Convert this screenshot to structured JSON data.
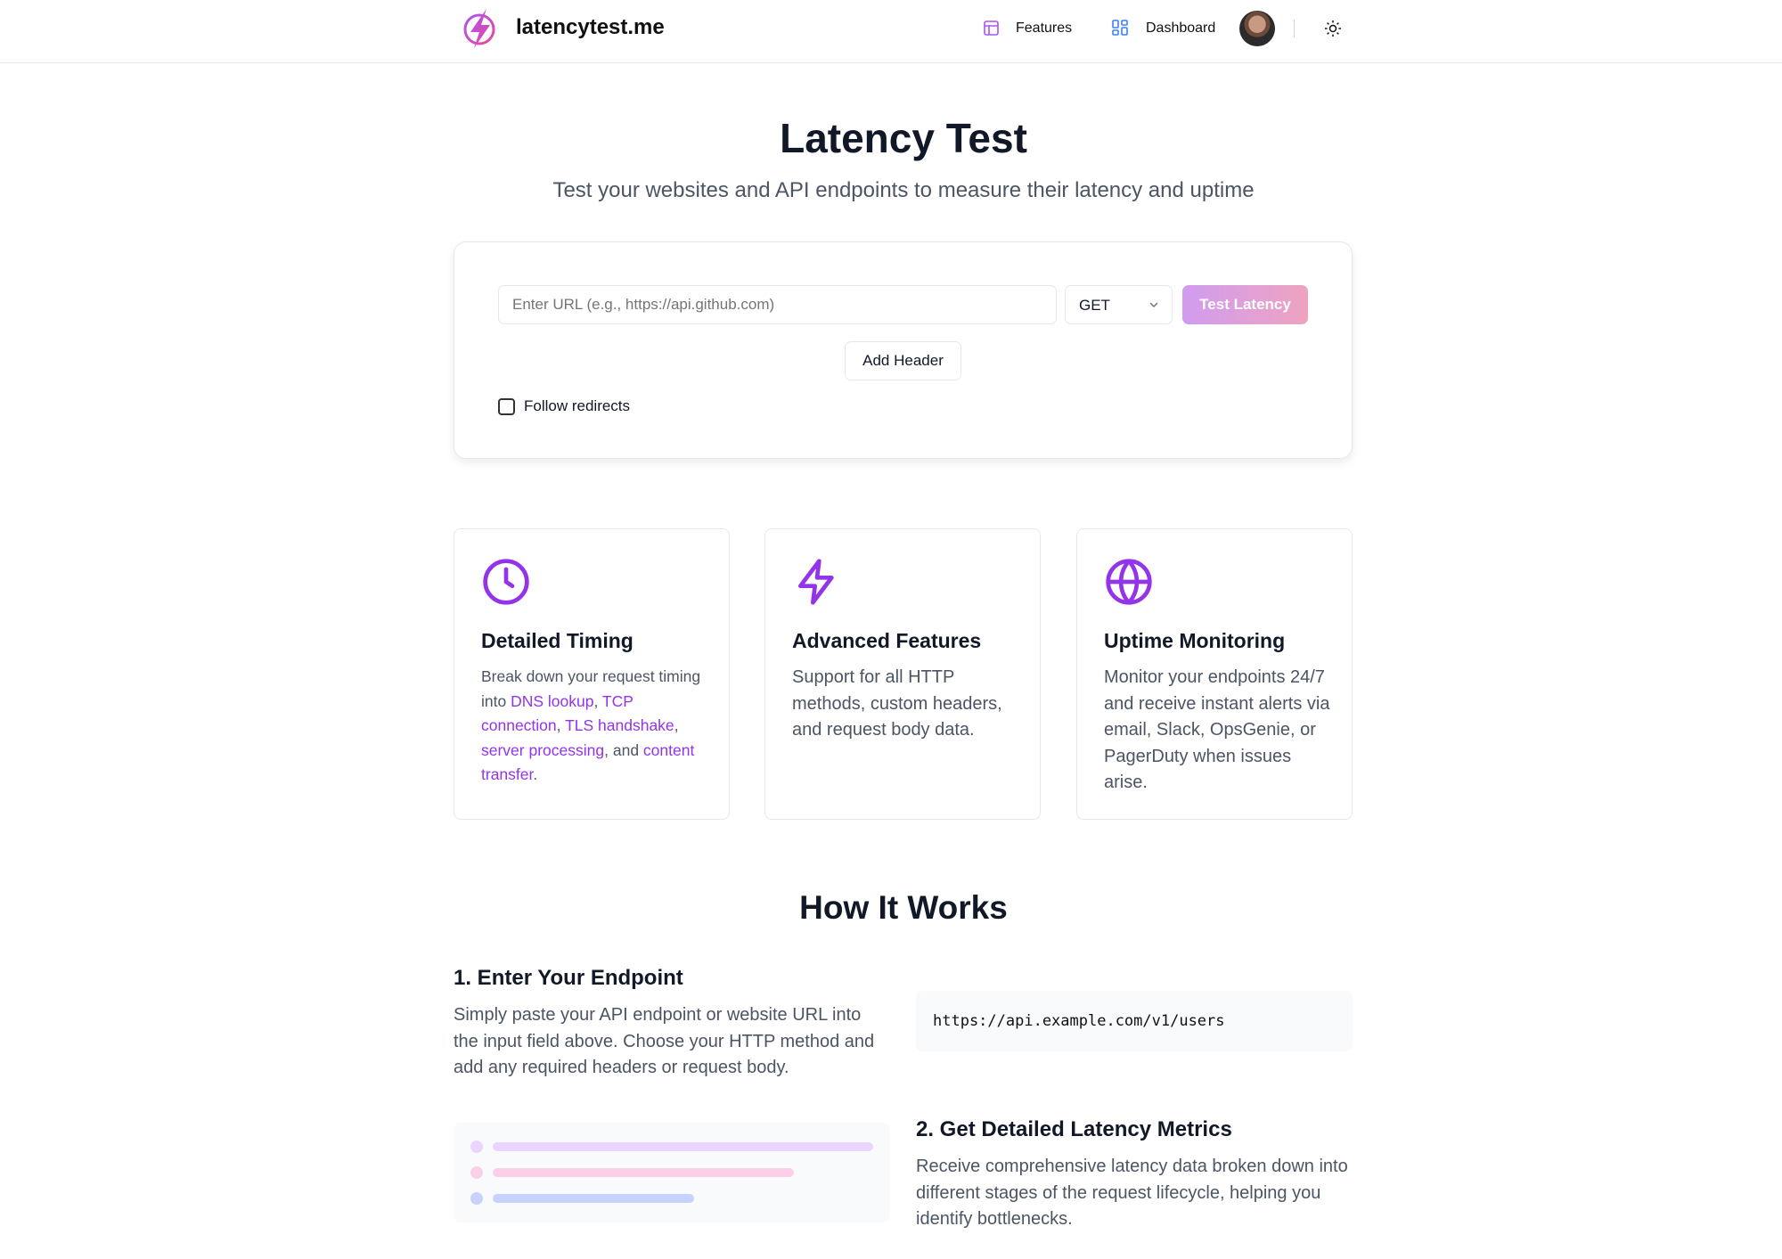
{
  "header": {
    "brand": "latencytest.me",
    "nav": [
      {
        "label": "Features",
        "icon": "layout-icon"
      },
      {
        "label": "Dashboard",
        "icon": "grid-icon"
      }
    ],
    "theme_icon": "sun-icon"
  },
  "hero": {
    "title": "Latency Test",
    "subtitle": "Test your websites and API endpoints to measure their latency and uptime"
  },
  "form": {
    "url_placeholder": "Enter URL (e.g., https://api.github.com)",
    "url_value": "",
    "method": "GET",
    "submit_label": "Test Latency",
    "add_header_label": "Add Header",
    "follow_redirects_label": "Follow redirects",
    "follow_redirects_checked": false
  },
  "features": [
    {
      "icon": "clock-icon",
      "title": "Detailed Timing",
      "body_parts": [
        "Break down your request timing into ",
        "DNS lookup",
        ", ",
        "TCP connection",
        ", ",
        "TLS handshake",
        ", ",
        "server processing",
        ", and ",
        "content transfer",
        "."
      ]
    },
    {
      "icon": "zap-icon",
      "title": "Advanced Features",
      "body": "Support for all HTTP methods, custom headers, and request body data."
    },
    {
      "icon": "globe-icon",
      "title": "Uptime Monitoring",
      "body": "Monitor your endpoints 24/7 and receive instant alerts via email, Slack, OpsGenie, or PagerDuty when issues arise."
    }
  ],
  "how": {
    "title": "How It Works",
    "steps": [
      {
        "title": "1. Enter Your Endpoint",
        "body": "Simply paste your API endpoint or website URL into the input field above. Choose your HTTP method and add any required headers or request body.",
        "code": "https://api.example.com/v1/users"
      },
      {
        "title": "2. Get Detailed Latency Metrics",
        "body": "Receive comprehensive latency data broken down into different stages of the request lifecycle, helping you identify bottlenecks."
      }
    ]
  },
  "colors": {
    "accent": "#9333ea",
    "bar1": "#e9d5ff",
    "bar2": "#fbcfe8",
    "bar3": "#c7d2fe"
  }
}
